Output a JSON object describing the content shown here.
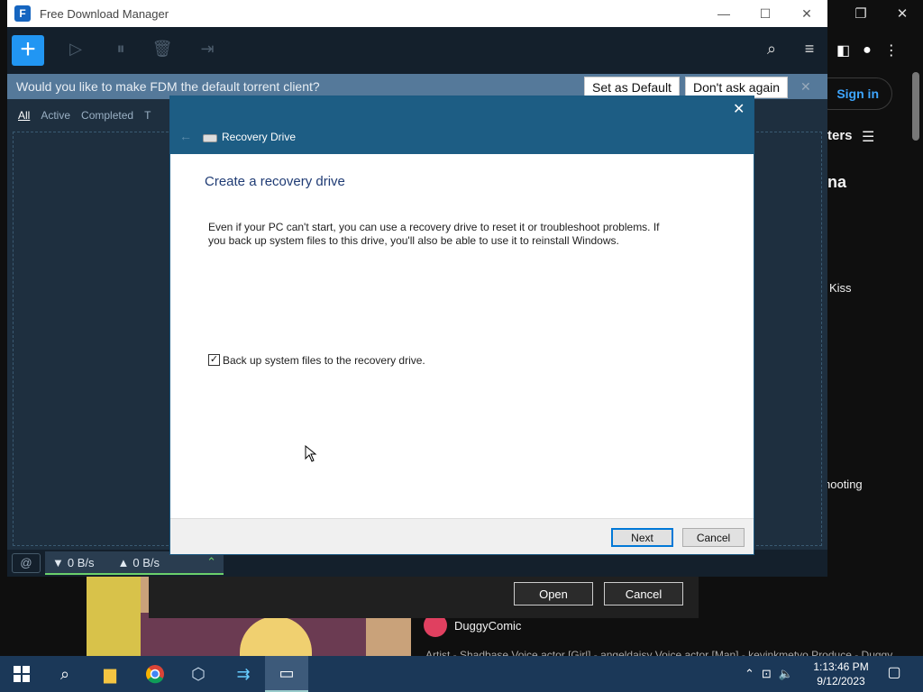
{
  "browser": {
    "sign_in": "Sign in",
    "filters_label": "ters",
    "text_a": "na",
    "text_kiss": ") Kiss",
    "text_shooting": "hooting",
    "channel_name": "DuggyComic",
    "description": "Artist - Shadbase Voice actor [Girl] - angeldaisy Voice actor [Man] - kevinkmetyo Produce - Duggy"
  },
  "fdm": {
    "title": "Free Download Manager",
    "banner_question": "Would you like to make FDM the default torrent client?",
    "set_default": "Set as Default",
    "dont_ask": "Don't ask again",
    "tabs": [
      "All",
      "Active",
      "Completed",
      "T"
    ],
    "download_speed": "0 B/s",
    "upload_speed": "0 B/s",
    "icons": [
      "add-icon",
      "play-icon",
      "pause-icon",
      "trash-icon",
      "move-folder-icon",
      "search-icon",
      "menu-icon"
    ]
  },
  "file_dialog": {
    "open": "Open",
    "cancel": "Cancel"
  },
  "recovery": {
    "window_title": "Recovery Drive",
    "heading": "Create a recovery drive",
    "body": "Even if your PC can't start, you can use a recovery drive to reset it or troubleshoot problems. If you back up system files to this drive, you'll also be able to use it to reinstall Windows.",
    "checkbox_label": "Back up system files to the recovery drive.",
    "checkbox_checked": true,
    "checkbox_mark": "✓",
    "next": "Next",
    "cancel": "Cancel"
  },
  "taskbar": {
    "time": "1:13:46 PM",
    "date": "9/12/2023",
    "apps": [
      "start-icon",
      "search-icon",
      "file-explorer-icon",
      "chrome-icon",
      "virtualbox-icon",
      "fdm-icon",
      "recovery-drive-icon"
    ]
  }
}
